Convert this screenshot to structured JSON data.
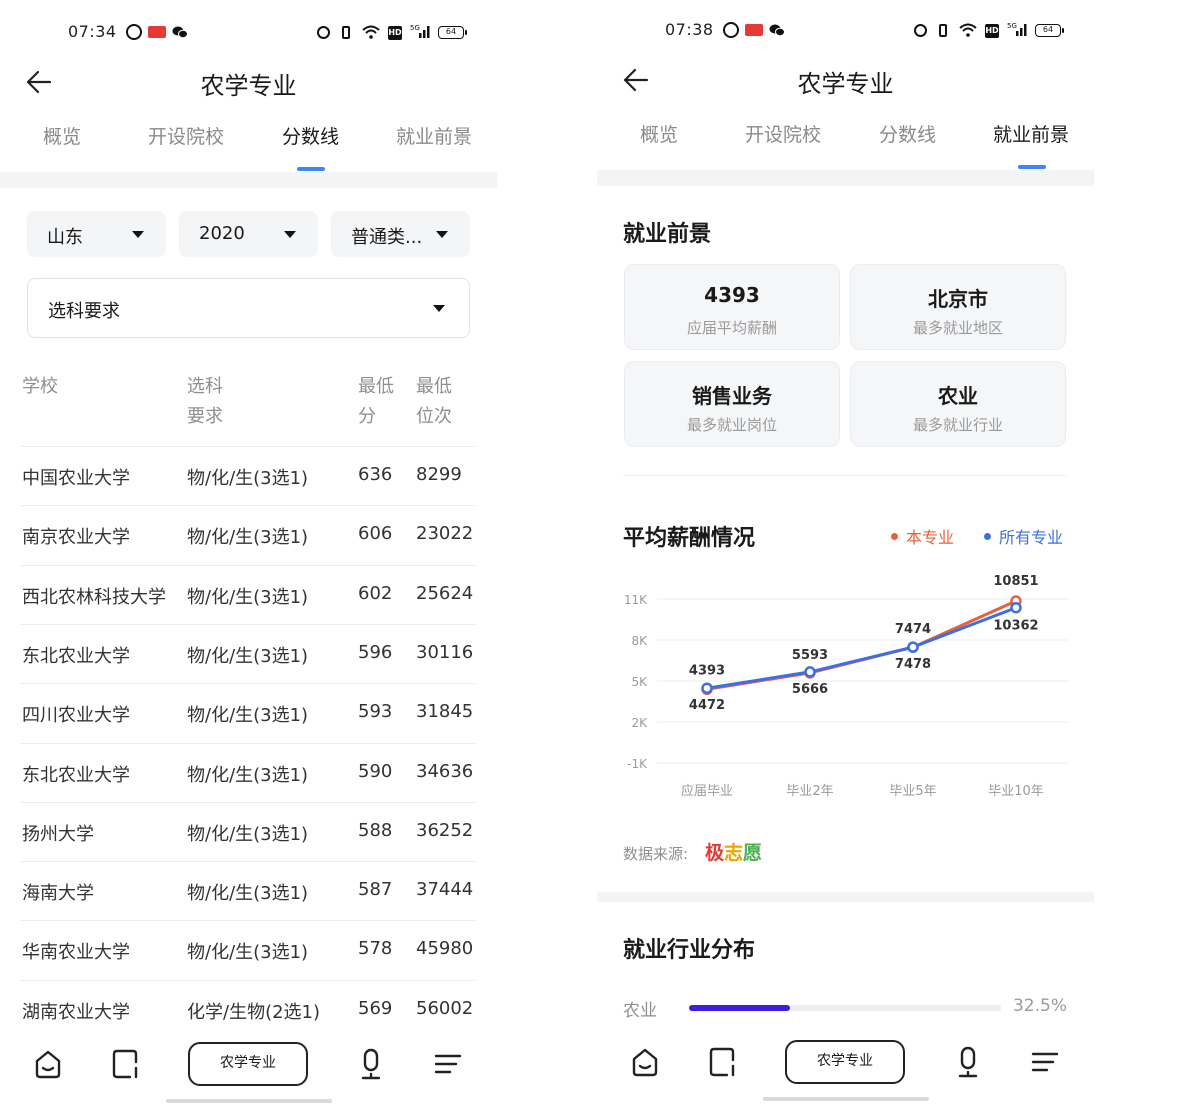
{
  "left": {
    "status": {
      "time": "07:34",
      "battery": "64"
    },
    "title": "农学专业",
    "tabs": [
      "概览",
      "开设院校",
      "分数线",
      "就业前景"
    ],
    "active_tab": "分数线",
    "filters": {
      "province": "山东",
      "year": "2020",
      "category": "普通类...",
      "subject_requirement": "选科要求"
    },
    "table": {
      "headers": {
        "school": "学校",
        "subject": "选科要求",
        "min_score": "最低分",
        "min_rank": "最低位次"
      },
      "header_lines": {
        "subject_1": "选科",
        "subject_2": "要求",
        "score_1": "最低",
        "score_2": "分",
        "rank_1": "最低",
        "rank_2": "位次"
      },
      "rows": [
        {
          "school": "中国农业大学",
          "subject": "物/化/生(3选1)",
          "score": "636",
          "rank": "8299"
        },
        {
          "school": "南京农业大学",
          "subject": "物/化/生(3选1)",
          "score": "606",
          "rank": "23022"
        },
        {
          "school": "西北农林科技大学",
          "subject": "物/化/生(3选1)",
          "score": "602",
          "rank": "25624"
        },
        {
          "school": "东北农业大学",
          "subject": "物/化/生(3选1)",
          "score": "596",
          "rank": "30116"
        },
        {
          "school": "四川农业大学",
          "subject": "物/化/生(3选1)",
          "score": "593",
          "rank": "31845"
        },
        {
          "school": "东北农业大学",
          "subject": "物/化/生(3选1)",
          "score": "590",
          "rank": "34636"
        },
        {
          "school": "扬州大学",
          "subject": "物/化/生(3选1)",
          "score": "588",
          "rank": "36252"
        },
        {
          "school": "海南大学",
          "subject": "物/化/生(3选1)",
          "score": "587",
          "rank": "37444"
        },
        {
          "school": "华南农业大学",
          "subject": "物/化/生(3选1)",
          "score": "578",
          "rank": "45980"
        },
        {
          "school": "湖南农业大学",
          "subject": "化学/生物(2选1)",
          "score": "569",
          "rank": "56002"
        }
      ]
    },
    "bottom_nav": {
      "center_label": "农学专业",
      "icons": [
        "home-icon",
        "card-icon",
        "mic-icon",
        "menu-icon"
      ]
    }
  },
  "right": {
    "status": {
      "time": "07:38",
      "battery": "64"
    },
    "title": "农学专业",
    "tabs": [
      "概览",
      "开设院校",
      "分数线",
      "就业前景"
    ],
    "active_tab": "就业前景",
    "prospects_title": "就业前景",
    "cards": [
      {
        "value": "4393",
        "label": "应届平均薪酬"
      },
      {
        "value": "北京市",
        "label": "最多就业地区"
      },
      {
        "value": "销售业务",
        "label": "最多就业岗位"
      },
      {
        "value": "农业",
        "label": "最多就业行业"
      }
    ],
    "salary_title": "平均薪酬情况",
    "legend": {
      "this_major": "本专业",
      "all_majors": "所有专业"
    },
    "colors": {
      "this_major": "#e8603c",
      "all_majors": "#3d6fe0",
      "tab_indicator": "#3f86f5",
      "industry_bar": "#3d1fe0"
    },
    "source_label": "数据来源:",
    "source_logo": {
      "c1": "极",
      "c2": "志",
      "c3": "愿"
    },
    "industry_title": "就业行业分布",
    "industry": {
      "name": "农业",
      "percent_label": "32.5%",
      "fraction": 0.325
    },
    "bottom_nav": {
      "center_label": "农学专业"
    }
  },
  "chart_data": {
    "type": "line",
    "categories": [
      "应届毕业",
      "毕业2年",
      "毕业5年",
      "毕业10年"
    ],
    "y_ticks": [
      "11K",
      "8K",
      "5K",
      "2K",
      "-1K"
    ],
    "ylim": [
      -1000,
      11000
    ],
    "series": [
      {
        "name": "本专业",
        "values": [
          4393,
          5593,
          7474,
          10851
        ]
      },
      {
        "name": "所有专业",
        "values": [
          4472,
          5666,
          7478,
          10362
        ]
      }
    ],
    "title": "平均薪酬情况"
  }
}
